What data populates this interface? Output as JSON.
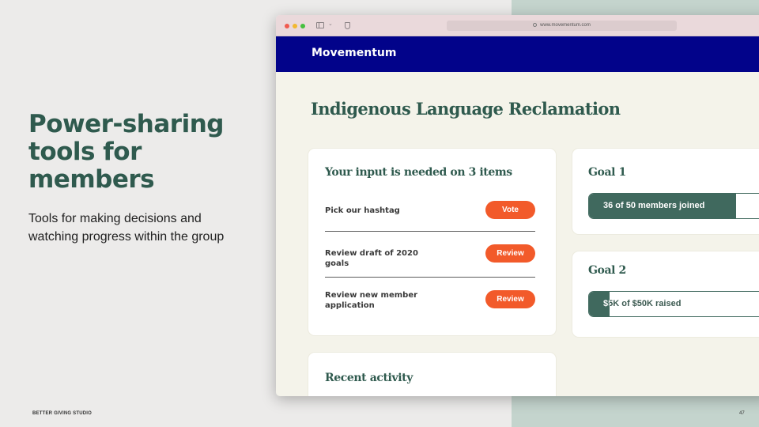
{
  "slide": {
    "title": "Power-sharing tools for members",
    "subtitle": "Tools for making decisions and watching progress within the group",
    "footer_left": "BETTER GIVING STUDIO",
    "page_number": "47"
  },
  "browser": {
    "url": "www.movementum.com"
  },
  "app": {
    "logo": "Movementum",
    "page_title": "Indigenous Language Reclamation",
    "input_card": {
      "heading": "Your input is needed on 3 items",
      "items": [
        {
          "label": "Pick our hashtag",
          "button": "Vote"
        },
        {
          "label": "Review draft of 2020 goals",
          "button": "Review"
        },
        {
          "label": "Review new member application",
          "button": "Review"
        }
      ]
    },
    "activity_card": {
      "heading": "Recent activity"
    },
    "goals": [
      {
        "heading": "Goal 1",
        "progress_text": "36 of 50 members joined",
        "progress_fraction": 0.72
      },
      {
        "heading": "Goal 2",
        "progress_text": "$5K of $50K raised",
        "progress_fraction": 0.1
      }
    ]
  },
  "colors": {
    "brand_navy": "#02038a",
    "primary_green": "#2f5a4e",
    "action_orange": "#f25a2a",
    "progress_green": "#40695e"
  },
  "icons": [
    "close-dot-icon",
    "minimize-dot-icon",
    "zoom-dot-icon",
    "sidebar-toggle-icon",
    "chevron-down-icon",
    "shield-icon",
    "lock-icon"
  ]
}
